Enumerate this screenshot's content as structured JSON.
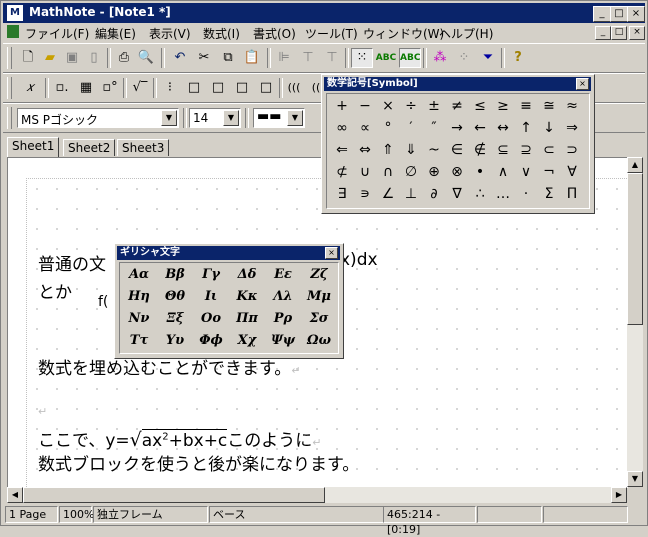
{
  "window": {
    "app": "MathNote",
    "title": "MathNote - [Note1 *]",
    "caption_minimize": "_",
    "caption_maximize": "□",
    "caption_close": "×"
  },
  "menu": [
    "ファイル(F)",
    "編集(E)",
    "表示(V)",
    "数式(I)",
    "書式(O)",
    "ツール(T)",
    "ウィンドウ(W)",
    "ヘルプ(H)"
  ],
  "toolbar1": [
    "new-doc-icon",
    "open-folder-icon",
    "save-icon",
    "page-icon",
    "print-icon",
    "print-preview-icon",
    "undo-icon",
    "cut-icon",
    "copy-icon",
    "paste-icon",
    "align-left-icon",
    "align-center-icon",
    "align-right-icon",
    "grid-icon",
    "formula-abc-icon",
    "formula-abc2-icon",
    "molecule-icon",
    "dots-icon",
    "funnel-icon",
    "help-icon"
  ],
  "toolbar1_labels": {
    "abc1": "ABC",
    "abc2": "ABC",
    "help": "?"
  },
  "toolbar2": {
    "items": [
      "𝑥",
      "▫.",
      "▦",
      "▫°",
      "√‾",
      "⁝",
      "□",
      "□",
      "□",
      "□",
      "(((",
      "(("
    ]
  },
  "toolbar3": {
    "font": "MS Pゴシック",
    "size": "14",
    "line": "▬▬"
  },
  "tabs": [
    "Sheet1",
    "Sheet2",
    "Sheet3"
  ],
  "document": {
    "line1_a": "普通の文",
    "line1_b": "x)dx",
    "line2": "とか",
    "line2_b": "f(",
    "line3": "数式を埋め込むことができます。",
    "line4_a": "ここで、y=",
    "line4_sqrt": "ax",
    "line4_sup": "2",
    "line4_b": "+bx+c",
    "line4_c": "このように",
    "line5": "数式ブロックを使うと後が楽になります。",
    "return_mark": "↵"
  },
  "symbol_palette": {
    "title": "数学記号[Symbol]",
    "rows": [
      [
        "+",
        "−",
        "×",
        "÷",
        "±",
        "≠",
        "≤",
        "≥",
        "≡",
        "≅",
        "≈"
      ],
      [
        "∞",
        "∝",
        "°",
        "′",
        "″",
        "→",
        "←",
        "↔",
        "↑",
        "↓",
        "⇒"
      ],
      [
        "⇐",
        "⇔",
        "⇑",
        "⇓",
        "~",
        "∈",
        "∉",
        "⊆",
        "⊇",
        "⊂",
        "⊃"
      ],
      [
        "⊄",
        "∪",
        "∩",
        "∅",
        "⊕",
        "⊗",
        "•",
        "∧",
        "∨",
        "¬",
        "∀"
      ],
      [
        "∃",
        "∍",
        "∠",
        "⊥",
        "∂",
        "∇",
        "∴",
        "…",
        "·",
        "Σ",
        "Π"
      ]
    ]
  },
  "greek_palette": {
    "title": "ギリシャ文字",
    "rows": [
      [
        "Αα",
        "Ββ",
        "Γγ",
        "Δδ",
        "Εε",
        "Ζζ"
      ],
      [
        "Ηη",
        "Θθ",
        "Ιι",
        "Κκ",
        "Λλ",
        "Μμ"
      ],
      [
        "Νν",
        "Ξξ",
        "Οο",
        "Ππ",
        "Ρρ",
        "Σσ"
      ],
      [
        "Ττ",
        "Υυ",
        "Φϕ",
        "Χχ",
        "Ψψ",
        "Ωω"
      ]
    ]
  },
  "status": {
    "page": "1 Page",
    "zoom": "100%",
    "frame": "独立フレーム",
    "base": "ベース",
    "pos": "465:214 - [0:19]"
  }
}
